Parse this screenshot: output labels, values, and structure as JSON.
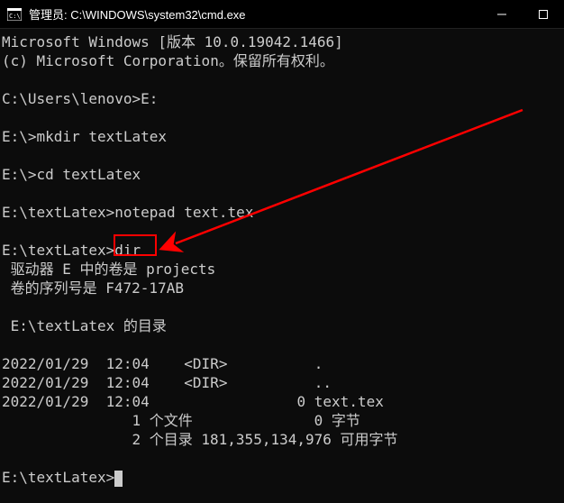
{
  "titlebar": {
    "title": "管理员: C:\\WINDOWS\\system32\\cmd.exe"
  },
  "console": {
    "line1": "Microsoft Windows [版本 10.0.19042.1466]",
    "line2": "(c) Microsoft Corporation。保留所有权利。",
    "blank1": "",
    "prompt1": "C:\\Users\\lenovo>",
    "cmd1": "E:",
    "blank2": "",
    "prompt2": "E:\\>",
    "cmd2": "mkdir textLatex",
    "blank3": "",
    "prompt3": "E:\\>",
    "cmd3": "cd textLatex",
    "blank4": "",
    "prompt4": "E:\\textLatex>",
    "cmd4": "notepad text.tex",
    "blank5": "",
    "prompt5": "E:\\textLatex>",
    "cmd5": "dir",
    "vol_line": " 驱动器 E 中的卷是 projects",
    "serial_line": " 卷的序列号是 F472-17AB",
    "blank6": "",
    "dirof_line": " E:\\textLatex 的目录",
    "blank7": "",
    "entry1": "2022/01/29  12:04    <DIR>          .",
    "entry2": "2022/01/29  12:04    <DIR>          ..",
    "entry3": "2022/01/29  12:04                 0 text.tex",
    "summary1": "               1 个文件              0 字节",
    "summary2": "               2 个目录 181,355,134,976 可用字节",
    "blank8": "",
    "prompt6": "E:\\textLatex>"
  }
}
